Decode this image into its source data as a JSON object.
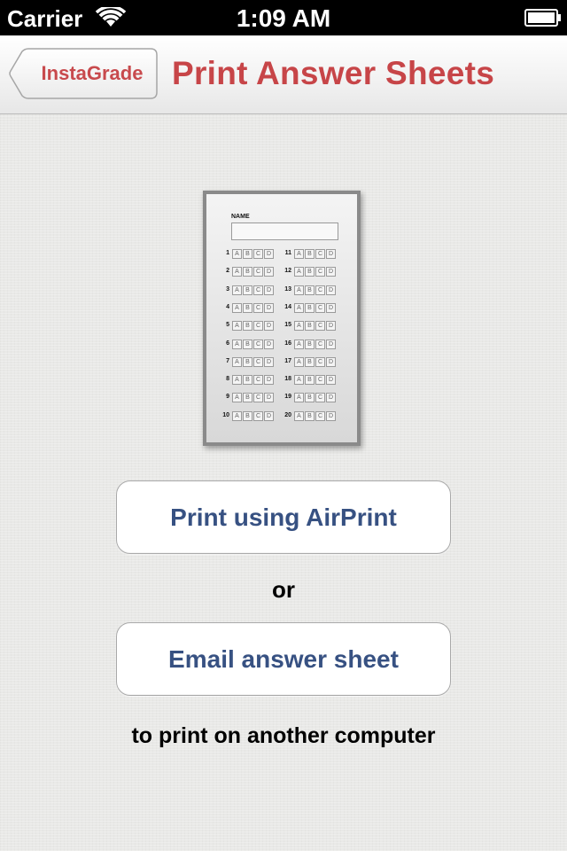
{
  "status_bar": {
    "carrier": "Carrier",
    "time": "1:09 AM"
  },
  "nav": {
    "back_label": "InstaGrade",
    "title": "Print Answer Sheets",
    "accent_color": "#c74548"
  },
  "sheet_preview": {
    "name_label": "NAME",
    "options": [
      "A",
      "B",
      "C",
      "D"
    ],
    "left_questions": [
      "1",
      "2",
      "3",
      "4",
      "5",
      "6",
      "7",
      "8",
      "9",
      "10"
    ],
    "right_questions": [
      "11",
      "12",
      "13",
      "14",
      "15",
      "16",
      "17",
      "18",
      "19",
      "20"
    ]
  },
  "actions": {
    "airprint_label": "Print using AirPrint",
    "or_text": "or",
    "email_label": "Email answer sheet",
    "footer_text": "to print on another computer",
    "button_text_color": "#375182"
  }
}
